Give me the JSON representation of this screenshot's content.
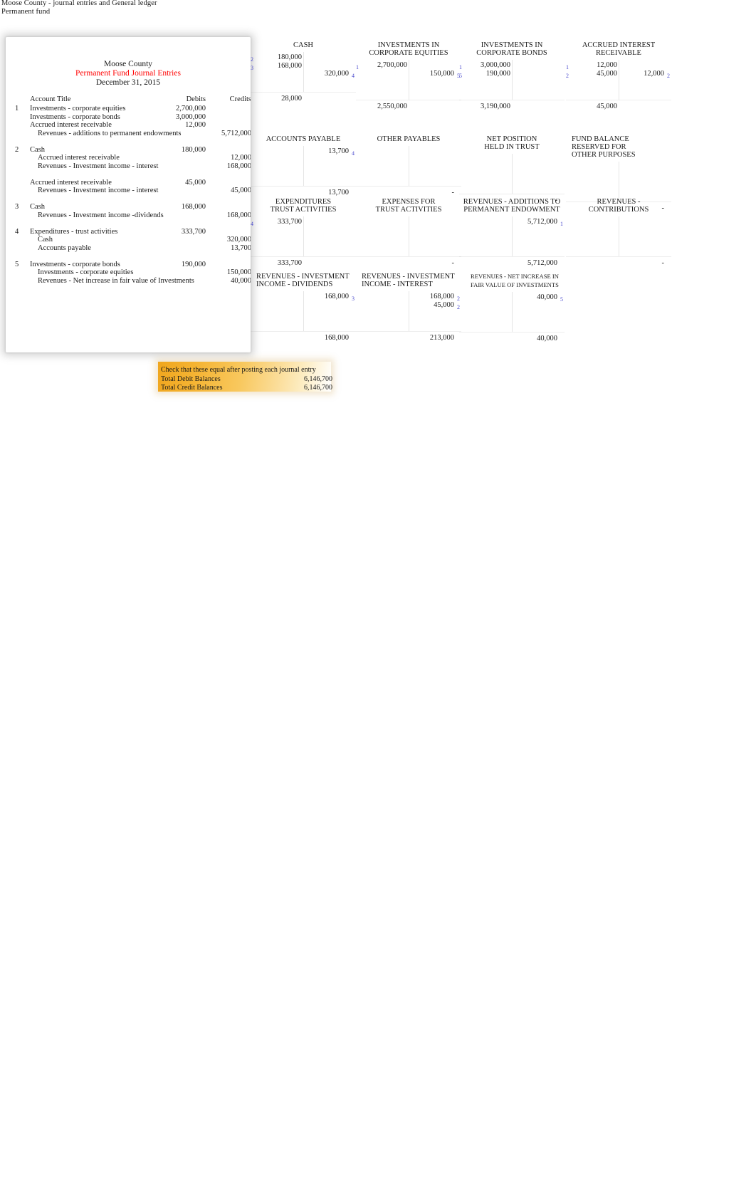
{
  "document": {
    "caption_line1": "Moose County - journal entries and General ledger",
    "caption_line2": "Permanent fund"
  },
  "journal": {
    "title_org": "Moose County",
    "title_doc": "Permanent Fund Journal Entries",
    "title_date": "December 31, 2015",
    "title_doc_color": "#ff0000",
    "columns": {
      "account": "Account Title",
      "debits": "Debits",
      "credits": "Credits"
    },
    "entries": [
      {
        "num": "1",
        "lines": [
          {
            "account": "Investments - corporate equities",
            "indent": false,
            "debit": "2,700,000",
            "credit": ""
          },
          {
            "account": "Investments - corporate bonds",
            "indent": false,
            "debit": "3,000,000",
            "credit": ""
          },
          {
            "account": "Accrued interest receivable",
            "indent": false,
            "debit": "12,000",
            "credit": ""
          },
          {
            "account": "Revenues - additions to permanent endowments",
            "indent": true,
            "debit": "",
            "credit": "5,712,000"
          }
        ]
      },
      {
        "num": "2",
        "lines": [
          {
            "account": "Cash",
            "indent": false,
            "debit": "180,000",
            "credit": ""
          },
          {
            "account": "Accrued interest receivable",
            "indent": true,
            "debit": "",
            "credit": "12,000"
          },
          {
            "account": "Revenues - Investment income - interest",
            "indent": true,
            "debit": "",
            "credit": "168,000"
          }
        ]
      },
      {
        "num": "",
        "lines": [
          {
            "account": "Accrued interest receivable",
            "indent": false,
            "debit": "45,000",
            "credit": ""
          },
          {
            "account": "Revenues - Investment income - interest",
            "indent": true,
            "debit": "",
            "credit": "45,000"
          }
        ]
      },
      {
        "num": "3",
        "lines": [
          {
            "account": "Cash",
            "indent": false,
            "debit": "168,000",
            "credit": ""
          },
          {
            "account": "Revenues - Investment income -dividends",
            "indent": true,
            "debit": "",
            "credit": "168,000"
          }
        ]
      },
      {
        "num": "4",
        "lines": [
          {
            "account": "Expenditures - trust activities",
            "indent": false,
            "debit": "333,700",
            "credit": ""
          },
          {
            "account": "Cash",
            "indent": true,
            "debit": "",
            "credit": "320,000"
          },
          {
            "account": "Accounts payable",
            "indent": true,
            "debit": "",
            "credit": "13,700"
          }
        ]
      },
      {
        "num": "5",
        "lines": [
          {
            "account": "Investments - corporate bonds",
            "indent": false,
            "debit": "190,000",
            "credit": ""
          },
          {
            "account": "Investments - corporate equities",
            "indent": true,
            "debit": "",
            "credit": "150,000"
          },
          {
            "account": "Revenues - Net increase in fair value of Investments",
            "indent": true,
            "debit": "",
            "credit": "40,000"
          }
        ]
      }
    ]
  },
  "ledger": {
    "accounts": [
      {
        "id": "cash",
        "title": [
          "CASH"
        ],
        "align": "center",
        "debits": [
          {
            "ref": "2",
            "amount": "180,000"
          },
          {
            "ref": "3",
            "amount": "168,000"
          }
        ],
        "credits": [
          {
            "ref": "4",
            "amount": "320,000"
          }
        ],
        "total_debit": "28,000",
        "total_credit": ""
      },
      {
        "id": "investments-corporate-equities",
        "title": [
          "INVESTMENTS IN",
          "CORPORATE EQUITIES"
        ],
        "align": "center",
        "debits": [
          {
            "ref": "1",
            "amount": "2,700,000"
          }
        ],
        "credits": [
          {
            "ref": "5",
            "amount": "150,000"
          }
        ],
        "total_debit": "2,550,000",
        "total_credit": ""
      },
      {
        "id": "investments-corporate-bonds",
        "title": [
          "INVESTMENTS IN",
          "CORPORATE BONDS"
        ],
        "align": "center",
        "debits": [
          {
            "ref": "1",
            "amount": "3,000,000"
          },
          {
            "ref": "5",
            "amount": "190,000"
          }
        ],
        "credits": [],
        "total_debit": "3,190,000",
        "total_credit": ""
      },
      {
        "id": "accrued-interest-receivable",
        "title": [
          "ACCRUED INTEREST",
          "RECEIVABLE"
        ],
        "align": "center",
        "debits": [
          {
            "ref": "1",
            "amount": "12,000"
          },
          {
            "ref": "2",
            "amount": "45,000"
          }
        ],
        "credits": [
          {
            "ref": "2",
            "amount": "12,000"
          }
        ],
        "total_debit": "45,000",
        "total_credit": ""
      },
      {
        "id": "accounts-payable",
        "title": [
          "ACCOUNTS PAYABLE"
        ],
        "align": "center",
        "debits": [],
        "credits": [
          {
            "ref": "4",
            "amount": "13,700"
          }
        ],
        "total_debit": "",
        "total_credit": "13,700"
      },
      {
        "id": "other-payables",
        "title": [
          "OTHER PAYABLES"
        ],
        "align": "center",
        "debits": [],
        "credits": [],
        "total_debit": "",
        "total_credit": "-"
      },
      {
        "id": "net-position-held-in-trust",
        "title": [
          "NET POSITION",
          " HELD IN TRUST"
        ],
        "align": "center",
        "debits": [],
        "credits": [],
        "total_debit": "",
        "total_credit": "-"
      },
      {
        "id": "fund-balance-reserved-other-purposes",
        "title": [
          "FUND BALANCE",
          "RESERVED FOR",
          "OTHER PURPOSES"
        ],
        "align": "left",
        "debits": [],
        "credits": [],
        "total_debit": "",
        "total_credit": "-"
      },
      {
        "id": "expenditures-trust-activities",
        "title": [
          "EXPENDITURES",
          "TRUST ACTIVITIES"
        ],
        "align": "center",
        "debits": [
          {
            "ref": "4",
            "amount": "333,700"
          }
        ],
        "credits": [],
        "total_debit": "333,700",
        "total_credit": ""
      },
      {
        "id": "expenses-for-trust-activities",
        "title": [
          "EXPENSES FOR",
          "TRUST ACTIVITIES"
        ],
        "align": "center",
        "debits": [],
        "credits": [],
        "total_debit": "",
        "total_credit": "-"
      },
      {
        "id": "revenues-additions-permanent-endowment",
        "title": [
          "REVENUES - ADDITIONS TO",
          "PERMANENT ENDOWMENT"
        ],
        "align": "center",
        "debits": [],
        "credits": [
          {
            "ref": "1",
            "amount": "5,712,000"
          }
        ],
        "total_debit": "",
        "total_credit": "5,712,000"
      },
      {
        "id": "revenues-contributions",
        "title": [
          "REVENUES -",
          "CONTRIBUTIONS"
        ],
        "align": "center",
        "debits": [],
        "credits": [],
        "total_debit": "",
        "total_credit": "-"
      },
      {
        "id": "revenues-investment-income-dividends",
        "title": [
          "REVENUES - INVESTMENT",
          "INCOME - DIVIDENDS"
        ],
        "align": "left",
        "debits": [],
        "credits": [
          {
            "ref": "3",
            "amount": "168,000"
          }
        ],
        "total_debit": "",
        "total_credit": "168,000"
      },
      {
        "id": "revenues-investment-income-interest",
        "title": [
          "REVENUES - INVESTMENT",
          "INCOME - INTEREST"
        ],
        "align": "left",
        "debits": [],
        "credits": [
          {
            "ref": "2",
            "amount": "168,000"
          },
          {
            "ref": "2",
            "amount": "45,000"
          }
        ],
        "total_debit": "",
        "total_credit": "213,000"
      },
      {
        "id": "revenues-net-increase-fair-value",
        "title": [
          "REVENUES - NET INCREASE IN",
          "FAIR VALUE OF INVESTMENTS"
        ],
        "align": "small",
        "debits": [],
        "credits": [
          {
            "ref": "5",
            "amount": "40,000"
          }
        ],
        "total_debit": "",
        "total_credit": "40,000"
      }
    ],
    "ref_color": "#4a4acd"
  },
  "check": {
    "note": "Check that these equal after posting each journal entry",
    "debit_label": "Total Debit Balances",
    "debit_value": "6,146,700",
    "credit_label": "Total Credit Balances",
    "credit_value": "6,146,700",
    "accent_color": "#f0a61e"
  }
}
